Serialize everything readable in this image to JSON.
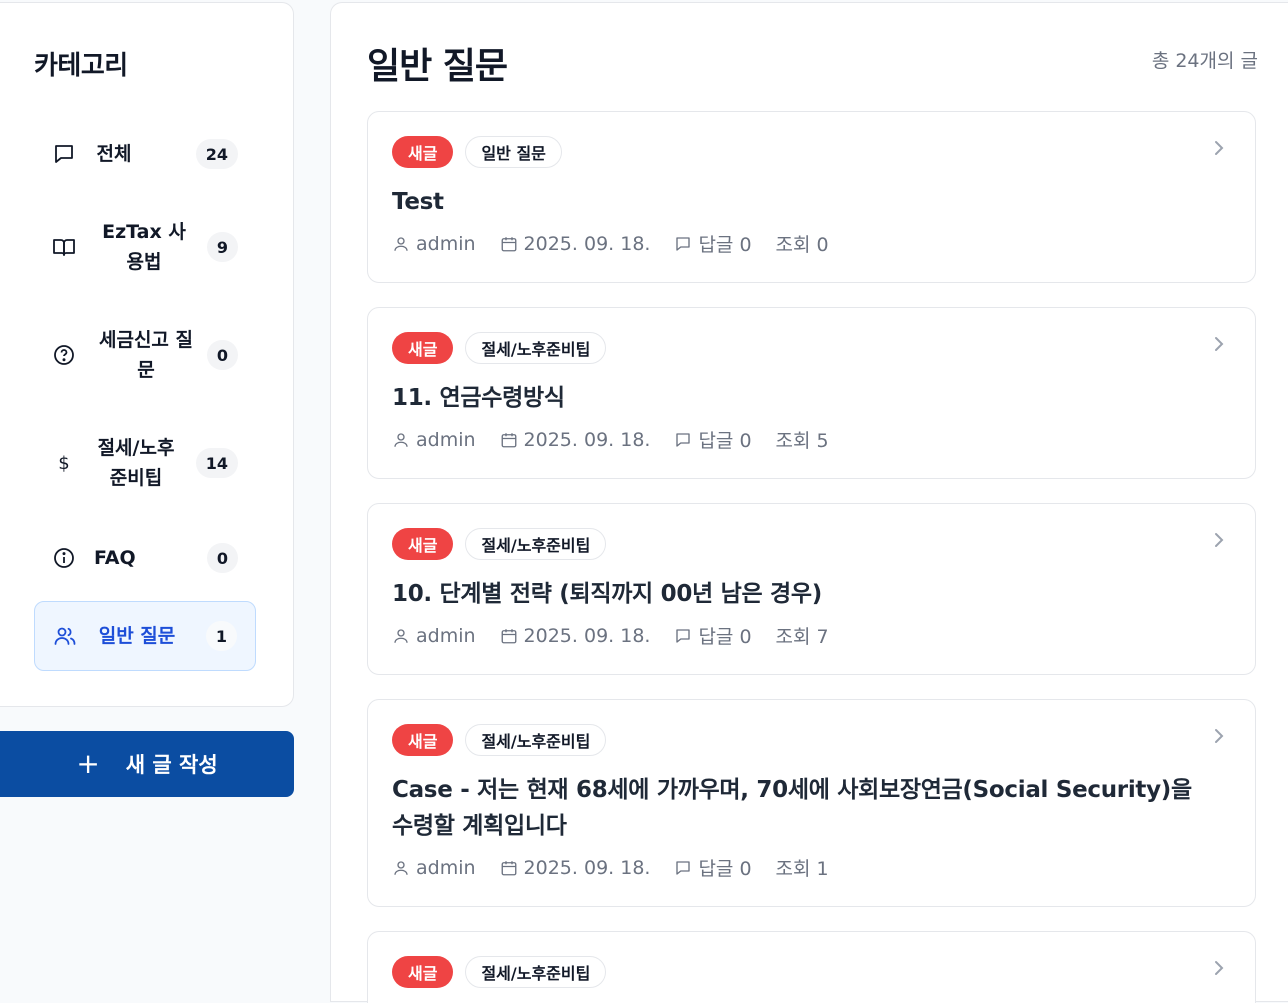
{
  "sidebar": {
    "title": "카테고리",
    "categories": [
      {
        "label": "전체",
        "count": "24",
        "icon": "message-square-icon"
      },
      {
        "label": "EzTax 사용법",
        "count": "9",
        "icon": "book-open-icon"
      },
      {
        "label": "세금신고 질문",
        "count": "0",
        "icon": "help-circle-icon"
      },
      {
        "label": "절세/노후준비팁",
        "count": "14",
        "icon": "dollar-sign-icon"
      },
      {
        "label": "FAQ",
        "count": "0",
        "icon": "info-icon"
      },
      {
        "label": "일반 질문",
        "count": "1",
        "icon": "users-icon",
        "active": true
      }
    ],
    "write_button": {
      "plus": "+",
      "label": "새 글 작성"
    }
  },
  "main": {
    "title": "일반 질문",
    "total": "총 24개의 글",
    "posts": [
      {
        "badge": "새글",
        "category": "일반 질문",
        "title": "Test",
        "author": "admin",
        "date": "2025. 09. 18.",
        "replies": "답글 0",
        "views": "조회 0"
      },
      {
        "badge": "새글",
        "category": "절세/노후준비팁",
        "title": "11. 연금수령방식",
        "author": "admin",
        "date": "2025. 09. 18.",
        "replies": "답글 0",
        "views": "조회 5"
      },
      {
        "badge": "새글",
        "category": "절세/노후준비팁",
        "title": "10. 단계별 전략 (퇴직까지 00년 남은 경우)",
        "author": "admin",
        "date": "2025. 09. 18.",
        "replies": "답글 0",
        "views": "조회 7"
      },
      {
        "badge": "새글",
        "category": "절세/노후준비팁",
        "title": "Case - 저는 현재 68세에 가까우며, 70세에 사회보장연금(Social Security)을 수령할 계획입니다",
        "author": "admin",
        "date": "2025. 09. 18.",
        "replies": "답글 0",
        "views": "조회 1"
      },
      {
        "badge": "새글",
        "category": "절세/노후준비팁"
      }
    ]
  },
  "colors": {
    "accent": "#0b4da2",
    "new_badge": "#ef4444",
    "active_bg": "#eff6ff",
    "active_text": "#1d4ed8"
  }
}
